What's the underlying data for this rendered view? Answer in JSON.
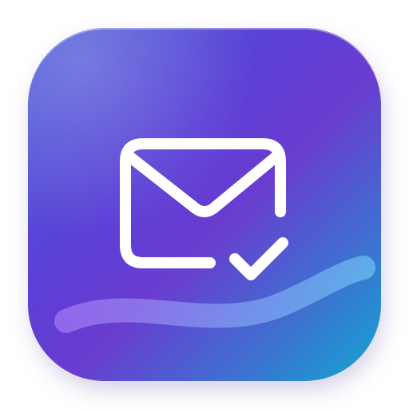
{
  "app_icon": {
    "name": "mail-check-icon",
    "colors": {
      "gradient_start": "#4a5fd8",
      "gradient_mid": "#6a3ccf",
      "gradient_end": "#12a7d2",
      "glyph": "#ffffff"
    }
  }
}
